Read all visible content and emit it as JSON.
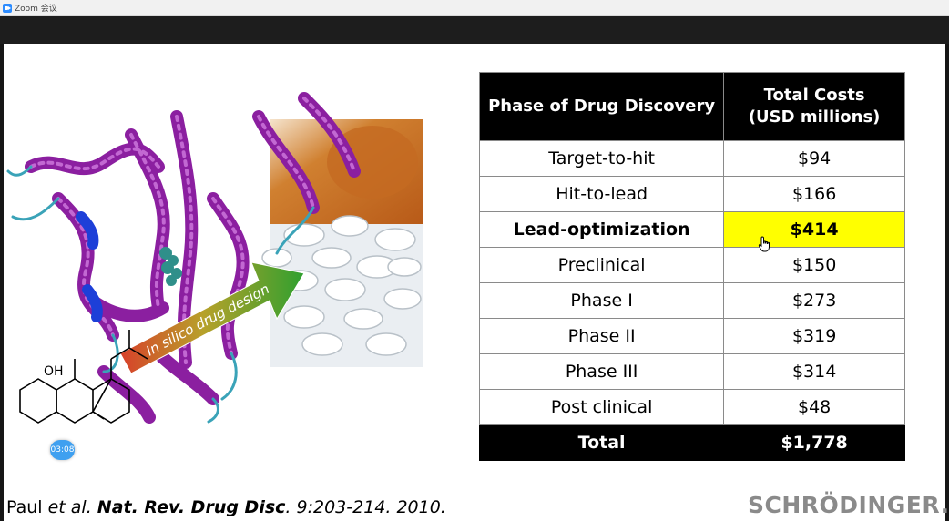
{
  "window": {
    "title": "Zoom 会议"
  },
  "slide": {
    "table": {
      "headers": [
        "Phase of Drug Discovery",
        "Total Costs",
        "(USD millions)"
      ],
      "rows": [
        {
          "phase": "Target-to-hit",
          "cost": "$94"
        },
        {
          "phase": "Hit-to-lead",
          "cost": "$166"
        },
        {
          "phase": "Lead-optimization",
          "cost": "$414"
        },
        {
          "phase": "Preclinical",
          "cost": "$150"
        },
        {
          "phase": "Phase I",
          "cost": "$273"
        },
        {
          "phase": "Phase II",
          "cost": "$319"
        },
        {
          "phase": "Phase III",
          "cost": "$314"
        },
        {
          "phase": "Post clinical",
          "cost": "$48"
        }
      ],
      "total": {
        "label": "Total",
        "value": "$1,778"
      },
      "highlight_color": "#ffff00"
    },
    "arrow_text": "In silico drug design",
    "molecule_label": "OH",
    "citation": {
      "authors": "Paul ",
      "etal": "et al.",
      "journal": "Nat. Rev. Drug Disc",
      "rest": ". 9:203-214. 2010."
    },
    "logo": "SCHRÖDINGER.",
    "timer": "03:08"
  }
}
